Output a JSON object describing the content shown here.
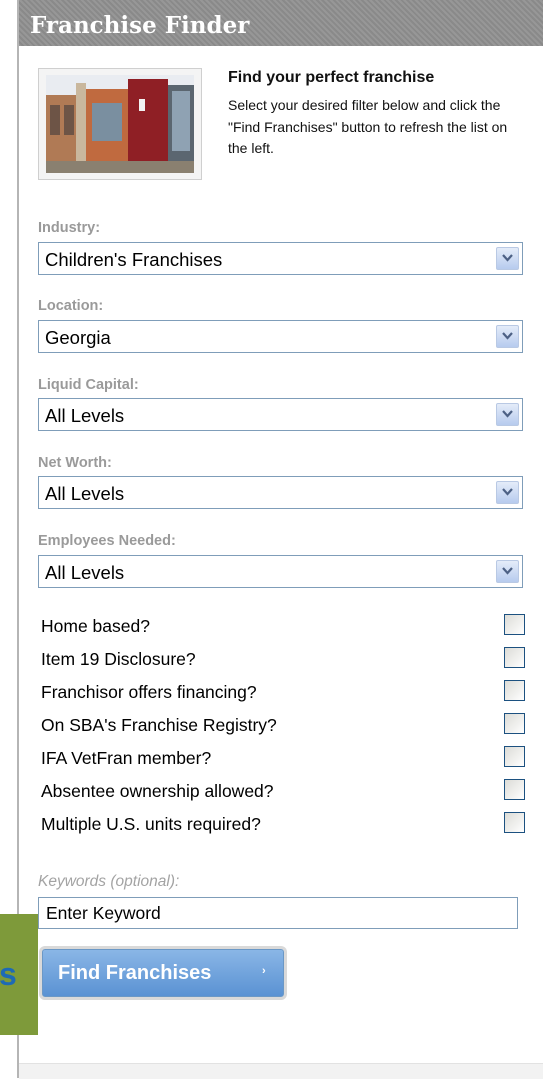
{
  "sidebar_tab": {
    "visible_fragment": "s"
  },
  "panel": {
    "title": "Franchise Finder",
    "intro_title": "Find your perfect franchise",
    "intro_body": "Select your desired filter below and click the \"Find Franchises\" button to refresh the list on the left."
  },
  "filters": [
    {
      "label": "Industry:",
      "value": "Children's Franchises"
    },
    {
      "label": "Location:",
      "value": "Georgia"
    },
    {
      "label": "Liquid Capital:",
      "value": "All Levels"
    },
    {
      "label": "Net Worth:",
      "value": "All Levels"
    },
    {
      "label": "Employees Needed:",
      "value": "All Levels"
    }
  ],
  "checkboxes": [
    {
      "label": "Home based?",
      "checked": false
    },
    {
      "label": "Item 19 Disclosure?",
      "checked": false
    },
    {
      "label": "Franchisor offers financing?",
      "checked": false
    },
    {
      "label": "On SBA's Franchise Registry?",
      "checked": false
    },
    {
      "label": "IFA VetFran member?",
      "checked": false
    },
    {
      "label": "Absentee ownership allowed?",
      "checked": false
    },
    {
      "label": "Multiple U.S. units required?",
      "checked": false
    }
  ],
  "keywords": {
    "label": "Keywords (optional):",
    "value": "Enter Keyword"
  },
  "find_button": {
    "label": "Find Franchises",
    "arrow": "›"
  },
  "colors": {
    "header_bg": "#8f8f8f",
    "filter_label": "#9a9a9a",
    "button_blue": "#6fa3dc",
    "side_tab_green": "#7e9a3a",
    "side_tab_text": "#1d6ab5"
  },
  "icons": {
    "dropdown": "chevron-down-icon",
    "thumbnail": "storefront-image"
  }
}
